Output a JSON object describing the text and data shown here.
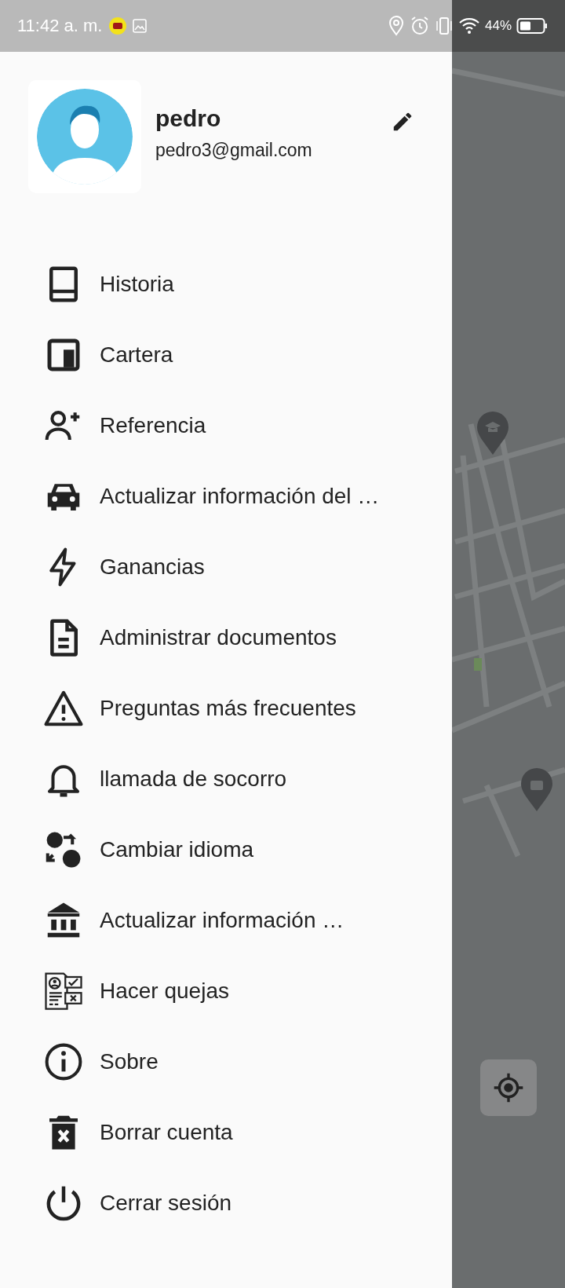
{
  "status_bar": {
    "time": "11:42 a. m.",
    "battery": "44%"
  },
  "profile": {
    "name": "pedro",
    "email": "pedro3@gmail.com"
  },
  "menu": [
    {
      "label": "Historia"
    },
    {
      "label": "Cartera"
    },
    {
      "label": "Referencia"
    },
    {
      "label": "Actualizar información del …"
    },
    {
      "label": "Ganancias"
    },
    {
      "label": "Administrar documentos"
    },
    {
      "label": "Preguntas más frecuentes"
    },
    {
      "label": "llamada de socorro"
    },
    {
      "label": "Cambiar idioma"
    },
    {
      "label": "Actualizar información …"
    },
    {
      "label": "Hacer quejas"
    },
    {
      "label": "Sobre"
    },
    {
      "label": "Borrar cuenta"
    },
    {
      "label": "Cerrar sesión"
    }
  ]
}
